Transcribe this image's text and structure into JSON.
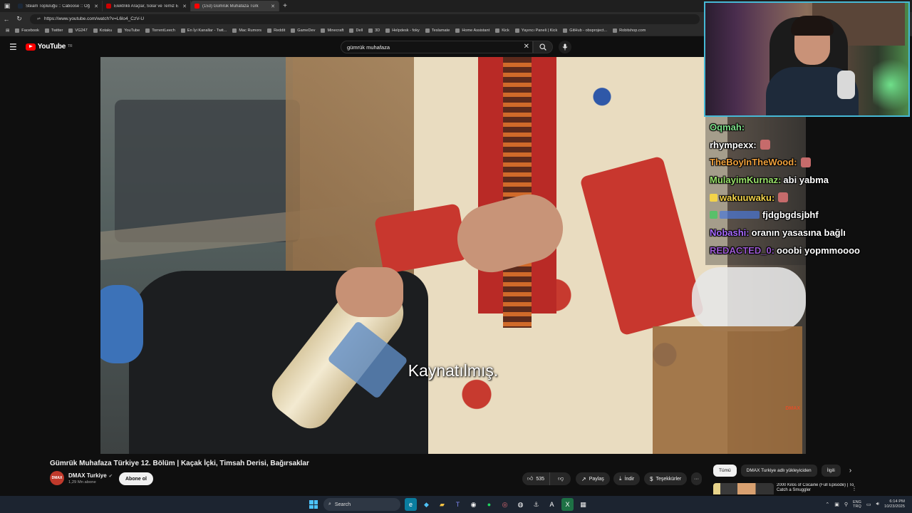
{
  "browser": {
    "tabs": [
      {
        "title": "Steam Topluluğu :: Caboose :: Öğ",
        "favicon_color": "#1b2838",
        "active": false
      },
      {
        "title": "Elektrikli Araçlar, Solar ve Temiz E",
        "favicon_color": "#cc0000",
        "active": false
      },
      {
        "title": "(153) Gümrük Muhafaza Türk",
        "favicon_color": "#ff0000",
        "active": true
      }
    ],
    "new_tab_glyph": "+",
    "url": "https://www.youtube.com/watch?v=L6lo4_CzV-U",
    "bookmarks": [
      "Facebook",
      "Twitter",
      "VG247",
      "Kotaku",
      "YouTube",
      "TorrentLeech",
      "En İyi Kanallar - Twit...",
      "Mac Rumors",
      "Reddit",
      "GameDev",
      "Minecraft",
      "Dell",
      "3D",
      "Helpdesk - foky",
      "Teslamate",
      "Home Assistant",
      "Kick",
      "Yayıncı Paneli | Kick",
      "GitHub - obsproject...",
      "Robitshop.com"
    ]
  },
  "youtube": {
    "logo_text": "YouTube",
    "logo_region": "TR",
    "search_query": "gümrük muhafaza",
    "subtitle": "Kaynatılmış.",
    "watermark": "DMAX",
    "video_title": "Gümrük Muhafaza Türkiye 12. Bölüm | Kaçak İçki, Timsah Derisi, Bağırsaklar",
    "channel": {
      "avatar_text": "DMAX",
      "name": "DMAX Turkiye",
      "subscribers": "1,29 Mn abone",
      "subscribe_label": "Abone ol"
    },
    "actions": {
      "likes": "535",
      "share": "Paylaş",
      "download": "İndir",
      "thanks": "Teşekkürler",
      "more": "···"
    },
    "chips": [
      {
        "label": "Tümü",
        "selected": true
      },
      {
        "label": "DMAX Turkiye adlı yükleyiciden",
        "selected": false
      },
      {
        "label": "İlgili",
        "selected": false
      }
    ],
    "recommendation_title": "2000 Kilos of Cocaine (Full Episode) | To Catch a Smuggler"
  },
  "chat": [
    {
      "user": "Oqmah:",
      "user_color": "#7ee08a",
      "text": "",
      "badge": "",
      "emote": false
    },
    {
      "user": "rhympexx:",
      "user_color": "#ffffff",
      "text": "",
      "badge": "",
      "emote": true
    },
    {
      "user": "TheBoyInTheWood:",
      "user_color": "#f0a13c",
      "text": "",
      "badge": "",
      "emote": true
    },
    {
      "user": "MulayimKurnaz:",
      "user_color": "#9be36b",
      "text": "abi yabma",
      "badge": "",
      "emote": false
    },
    {
      "user": "wakuuwaku:",
      "user_color": "#f3d34a",
      "text": "",
      "badge": "#f3d34a",
      "emote": true
    },
    {
      "user": "",
      "user_color": "#4a78d8",
      "text": "fjdgbgdsjbhf",
      "badge": "#59c06a",
      "emote": false
    },
    {
      "user": "Nobashi:",
      "user_color": "#a86bff",
      "text": "oranın yasasına bağlı",
      "badge": "",
      "emote": false
    },
    {
      "user": "REDACTED_0:",
      "user_color": "#9b59d0",
      "text": "ooobi yopmmoooo",
      "badge": "",
      "emote": false
    }
  ],
  "taskbar": {
    "search_placeholder": "Search",
    "lang_top": "ENG",
    "lang_bottom": "TRQ",
    "time": "6:14 PM",
    "date": "10/23/2025"
  }
}
